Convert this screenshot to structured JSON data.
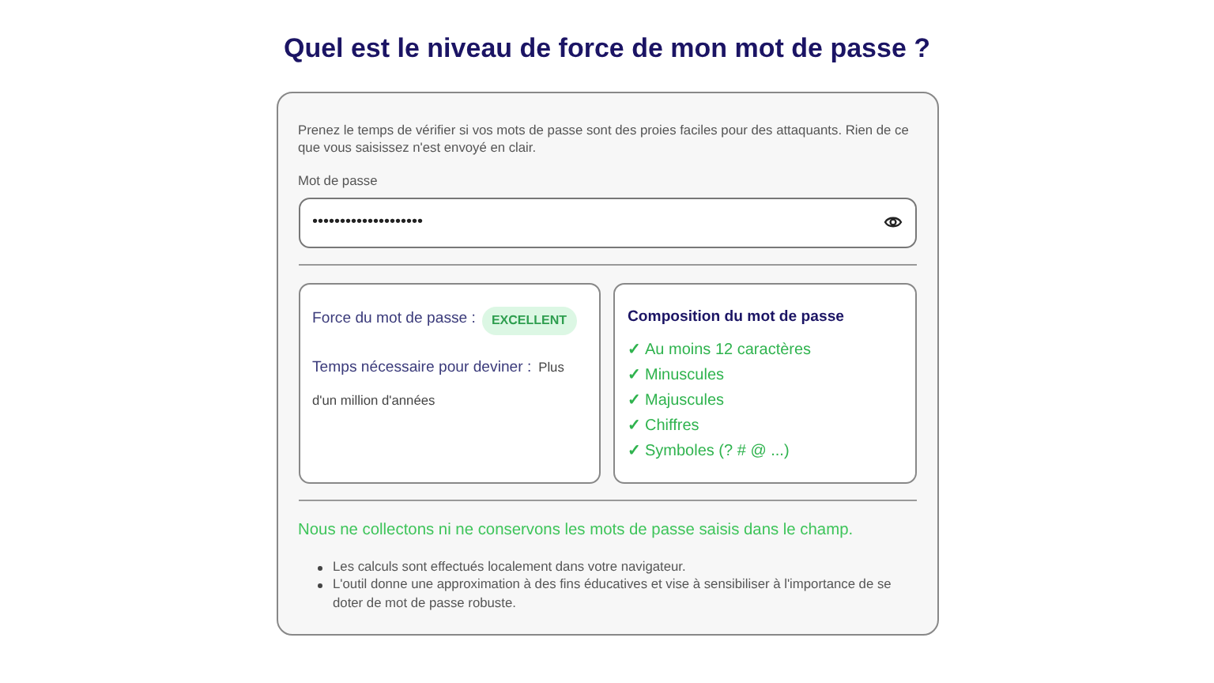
{
  "title": "Quel est le niveau de force de mon mot de passe ?",
  "intro": "Prenez le temps de vérifier si vos mots de passe sont des proies faciles pour des attaquants. Rien de ce que vous saisissez n'est envoyé en clair.",
  "password": {
    "label": "Mot de passe",
    "value": "••••••••••••••••••••"
  },
  "strength": {
    "label": "Force du mot de passe :",
    "badge": "EXCELLENT",
    "time_label": "Temps nécessaire pour deviner :",
    "time_value": "Plus d'un million d'années"
  },
  "composition": {
    "title": "Composition du mot de passe",
    "items": [
      {
        "check": "✓",
        "label": "Au moins 12 caractères",
        "met": true
      },
      {
        "check": "✓",
        "label": "Minuscules",
        "met": true
      },
      {
        "check": "✓",
        "label": "Majuscules",
        "met": true
      },
      {
        "check": "✓",
        "label": "Chiffres",
        "met": true
      },
      {
        "check": "✓",
        "label": "Symboles (? # @ ...)",
        "met": true
      }
    ]
  },
  "privacy_note": "Nous ne collectons ni ne conservons les mots de passe saisis dans le champ.",
  "notes": [
    "Les calculs sont effectués localement dans votre navigateur.",
    "L'outil donne une approximation à des fins éducatives et vise à sensibiliser à l'importance de se doter de mot de passe robuste."
  ]
}
